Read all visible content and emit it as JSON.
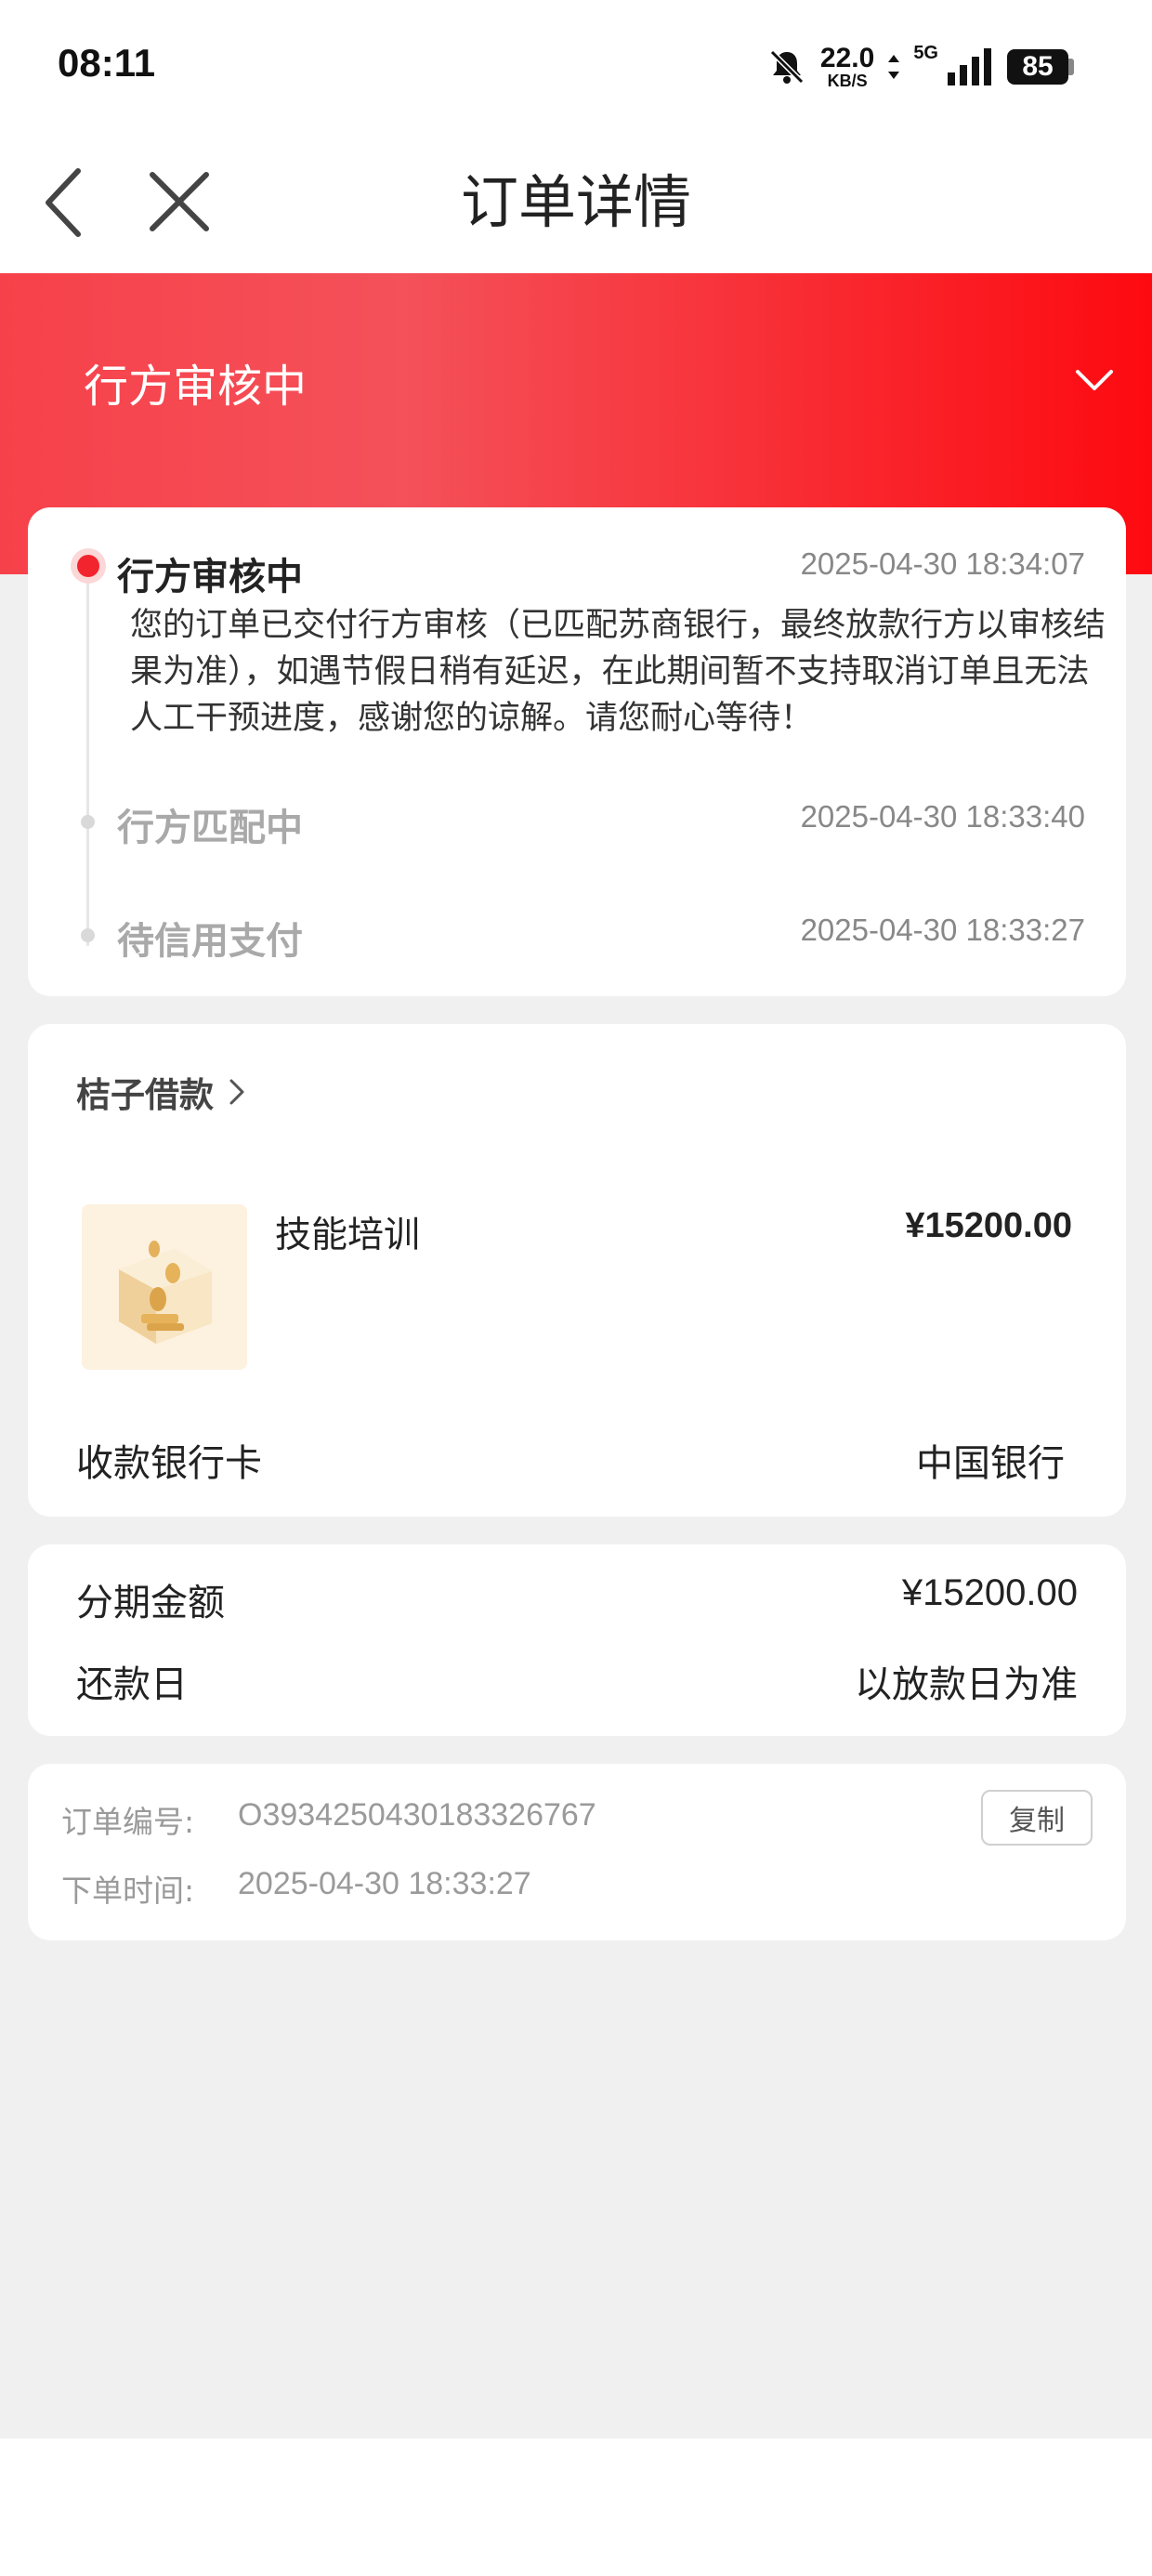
{
  "status_bar": {
    "time": "08:11",
    "net_speed": "22.0",
    "net_unit": "KB/S",
    "network": "5G",
    "battery": "85",
    "icons": [
      "mute-bell-icon",
      "data-arrows-icon",
      "signal-icon",
      "battery-icon"
    ]
  },
  "nav": {
    "title": "订单详情",
    "icons": [
      "back-icon",
      "close-icon"
    ]
  },
  "banner": {
    "status": "行方审核中",
    "chevron": "chevron-down-icon",
    "gradient": [
      "#f7414a",
      "#fd0a10"
    ]
  },
  "timeline": [
    {
      "title": "行方审核中",
      "time": "2025-04-30 18:34:07",
      "desc": "您的订单已交付行方审核（已匹配苏商银行，最终放款行方以审核结果为准），如遇节假日稍有延迟，在此期间暂不支持取消订单且无法人工干预进度，感谢您的谅解。请您耐心等待！",
      "active": true
    },
    {
      "title": "行方匹配中",
      "time": "2025-04-30 18:33:40",
      "active": false
    },
    {
      "title": "待信用支付",
      "time": "2025-04-30 18:33:27",
      "active": false
    }
  ],
  "product": {
    "shop_name": "桔子借款",
    "name": "技能培训",
    "price": "¥15200.00",
    "bank_label": "收款银行卡",
    "bank_value": "中国银行"
  },
  "installment": {
    "amount_label": "分期金额",
    "amount_value": "¥15200.00",
    "repay_label": "还款日",
    "repay_value": "以放款日为准"
  },
  "order": {
    "number_label": "订单编号:",
    "number_value": "O393425043018332676​7",
    "time_label": "下单时间:",
    "time_value": "2025-04-30 18:33:27",
    "copy_label": "复制"
  },
  "colors": {
    "accent_red": "#f2242d",
    "background": "#f0f0f0"
  }
}
